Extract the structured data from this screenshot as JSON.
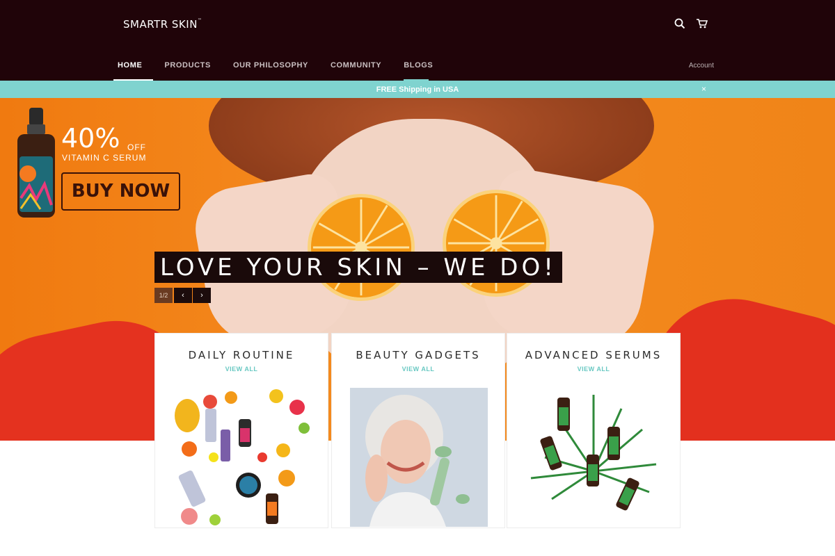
{
  "header": {
    "logo": "SMARTR SKIN",
    "logo_mark": "™",
    "icons": [
      "search-icon",
      "cart-icon"
    ],
    "nav": [
      {
        "label": "HOME",
        "active": true
      },
      {
        "label": "PRODUCTS",
        "active": false
      },
      {
        "label": "OUR PHILOSOPHY",
        "active": false
      },
      {
        "label": "COMMUNITY",
        "active": false
      },
      {
        "label": "BLOGS",
        "active": false
      }
    ],
    "account": "Account"
  },
  "announcement": {
    "text": "FREE Shipping in USA",
    "close": "×"
  },
  "hero": {
    "promo": {
      "percent": "40%",
      "off": "OFF",
      "product": "VITAMIN C SERUM",
      "button": "BUY NOW"
    },
    "tagline": "LOVE YOUR SKIN – WE DO!",
    "slide_counter": "1/2",
    "prev": "‹",
    "next": "›"
  },
  "collections": [
    {
      "title": "DAILY ROUTINE",
      "link": "VIEW ALL"
    },
    {
      "title": "BEAUTY GADGETS",
      "link": "VIEW ALL"
    },
    {
      "title": "ADVANCED SERUMS",
      "link": "VIEW ALL"
    }
  ],
  "colors": {
    "header_bg": "#200409",
    "accent_teal": "#7fd3cf",
    "hero_orange": "#f58c20"
  }
}
